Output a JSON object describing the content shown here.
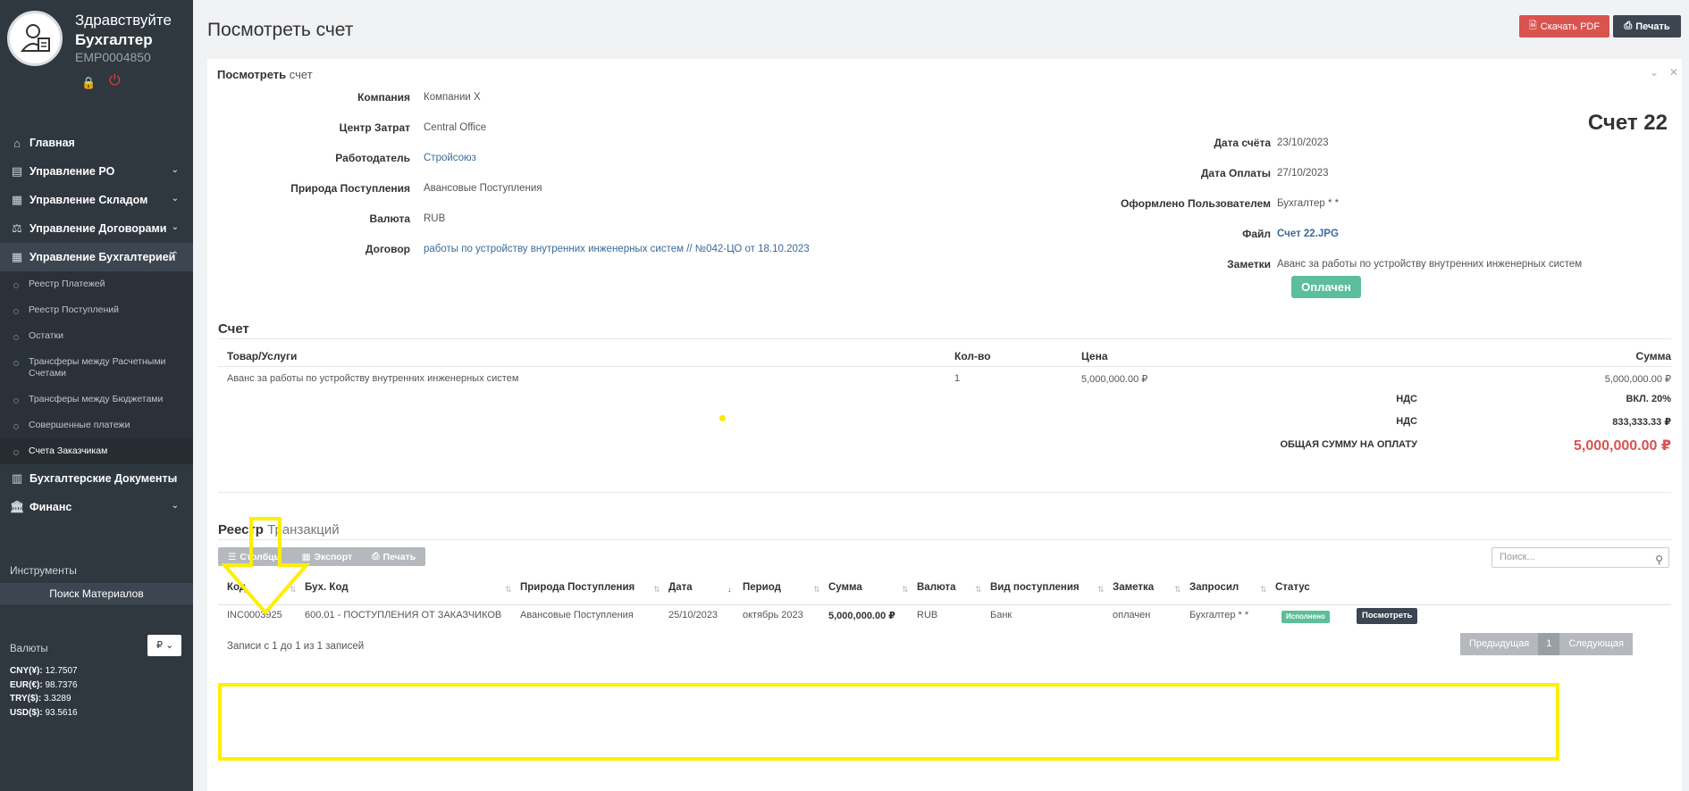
{
  "sidebar": {
    "greeting": "Здравствуйте",
    "user_name": "Бухгалтер",
    "employee_id": "EMP0004850",
    "menu": [
      {
        "label": "Главная",
        "icon": "home-icon",
        "glyph": "⌂"
      },
      {
        "label": "Управление PO",
        "icon": "truck-icon",
        "glyph": "▤"
      },
      {
        "label": "Управление Складом",
        "icon": "warehouse-icon",
        "glyph": "▦"
      },
      {
        "label": "Управление Договорами",
        "icon": "scale-icon",
        "glyph": "⚖"
      },
      {
        "label": "Управление Бухгалтерией",
        "icon": "grid-icon",
        "glyph": "▦"
      }
    ],
    "submenu": [
      "Реестр Платежей",
      "Реестр Поступлений",
      "Остатки",
      "Трансферы между Расчетными Счетами",
      "Трансферы между Бюджетами",
      "Совершенные платежи",
      "Счета Заказчикам"
    ],
    "menu_after": [
      {
        "label": "Бухгалтерские Документы",
        "icon": "books-icon",
        "glyph": "▥"
      },
      {
        "label": "Финанс",
        "icon": "bank-icon",
        "glyph": "⌂"
      }
    ],
    "tools_title": "Инструменты",
    "tools_button": "Поиск Материалов",
    "currencies_title": "Валюты",
    "currency_selected": "₽",
    "rates": [
      {
        "code": "CNY(¥):",
        "value": "12.7507"
      },
      {
        "code": "EUR(€):",
        "value": "98.7376"
      },
      {
        "code": "TRY($):",
        "value": "3.3289"
      },
      {
        "code": "USD($):",
        "value": "93.5616"
      }
    ]
  },
  "header": {
    "title": "Посмотреть счет",
    "pdf_button": "Скачать PDF",
    "print_button": "Печать"
  },
  "panel": {
    "title_bold": "Посмотреть",
    "title_rest": "счет",
    "invoice_number": "Счет 22",
    "left_fields": [
      {
        "label": "Компания",
        "value": "Компании X"
      },
      {
        "label": "Центр Затрат",
        "value": "Central Office"
      },
      {
        "label": "Работодатель",
        "value": "Стройсоюз"
      },
      {
        "label": "Природа Поступления",
        "value": "Авансовые Поступления"
      },
      {
        "label": "Валюта",
        "value": "RUB"
      },
      {
        "label": "Договор",
        "value": "работы по устройству внутренних инженерных систем // №042-ЦО от 18.10.2023"
      }
    ],
    "right_fields": [
      {
        "label": "Дата счёта",
        "value": "23/10/2023"
      },
      {
        "label": "Дата Оплаты",
        "value": "27/10/2023"
      },
      {
        "label": "Оформлено Пользователем",
        "value": "Бухгалтер * *"
      },
      {
        "label": "Файл",
        "value": "Счет 22.JPG"
      },
      {
        "label": "Заметки",
        "value": "Аванс за работы по устройству внутренних инженерных систем"
      }
    ],
    "status": "Оплачен"
  },
  "invoice": {
    "section_title": "Счет",
    "headers": {
      "item": "Товар/Услуги",
      "qty": "Кол-во",
      "price": "Цена",
      "sum": "Сумма"
    },
    "row": {
      "item": "Аванс за работы по устройству внутренних инженерных систем",
      "qty": "1",
      "price": "5,000,000.00 ₽",
      "sum": "5,000,000.00 ₽"
    },
    "vat_label": "НДС",
    "vat_rate": "ВКЛ. 20%",
    "vat_label2": "НДС",
    "vat_amount": "833,333.33 ₽",
    "total_label": "ОБЩАЯ СУММУ НА ОПЛАТУ",
    "total_amount": "5,000,000.00 ₽"
  },
  "transactions": {
    "title_bold": "Реестр",
    "title_rest": "Транзакций",
    "toolbar": {
      "columns": "Столбцы",
      "export": "Экспорт",
      "print": "Печать"
    },
    "search_placeholder": "Поиск...",
    "headers": [
      "Код",
      "Бух. Код",
      "Природа Поступления",
      "Дата",
      "Период",
      "Сумма",
      "Валюта",
      "Вид поступления",
      "Заметка",
      "Запросил",
      "Статус"
    ],
    "row": {
      "code": "INC0003925",
      "acc_code": "600.01 - ПОСТУПЛЕНИЯ ОТ ЗАКАЗЧИКОВ",
      "nature": "Авансовые Поступления",
      "date": "25/10/2023",
      "period": "октябрь 2023",
      "sum": "5,000,000.00 ₽",
      "currency": "RUB",
      "type": "Банк",
      "note": "оплачен",
      "requested_by": "Бухгалтер * *",
      "status": "Исполнено",
      "view_button": "Посмотреть"
    },
    "records_info": "Записи с 1 до 1 из 1 записей",
    "pager": {
      "prev": "Предыдущая",
      "page": "1",
      "next": "Следующая"
    }
  },
  "colors": {
    "sidebar": "#2f373f",
    "accent_red": "#d9534f",
    "badge_green": "#5cbe9a",
    "link": "#3a6a9a",
    "highlight": "#ffee00"
  }
}
